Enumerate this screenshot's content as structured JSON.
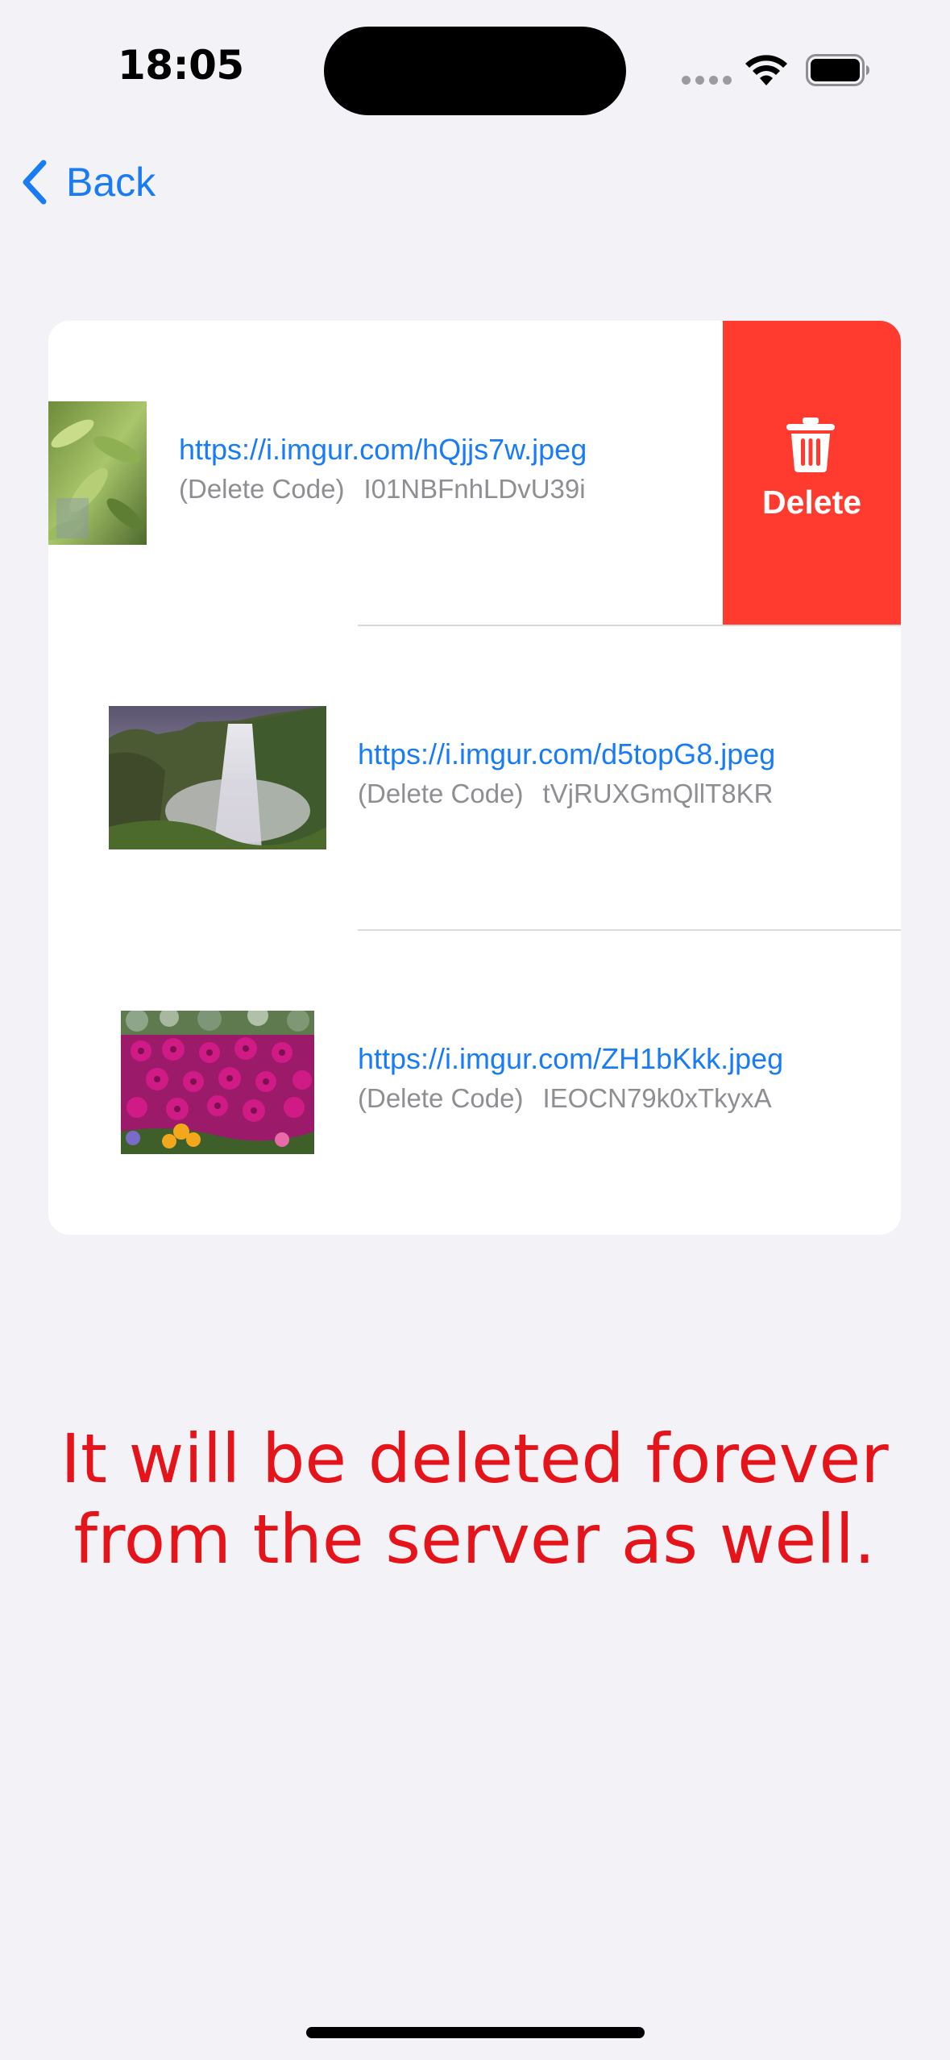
{
  "status_bar": {
    "time": "18:05",
    "icons": [
      "signal-dots-icon",
      "wifi-icon",
      "battery-icon"
    ]
  },
  "nav": {
    "back_label": "Back",
    "back_icon": "chevron-left-icon"
  },
  "uploads": [
    {
      "url": "https://i.imgur.com/hQjjs7w.jpeg",
      "code_label": "(Delete Code)",
      "code": "I01NBFnhLDvU39i",
      "thumbnail": "leaves-photo"
    },
    {
      "url": "https://i.imgur.com/d5topG8.jpeg",
      "code_label": "(Delete Code)",
      "code": "tVjRUXGmQllT8KR",
      "thumbnail": "waterfall-photo"
    },
    {
      "url": "https://i.imgur.com/ZH1bKkk.jpeg",
      "code_label": "(Delete Code)",
      "code": "IEOCN79k0xTkyxA",
      "thumbnail": "flowers-photo"
    }
  ],
  "swipe_action": {
    "label": "Delete",
    "icon": "trash-icon",
    "color": "#FF3B30"
  },
  "warning": {
    "line1": "It will be deleted forever",
    "line2": "from the server as well.",
    "color": "#E5141B"
  },
  "colors": {
    "accent": "#1A7CF5",
    "background": "#F2F2F7",
    "secondary_text": "#8E8E93"
  }
}
